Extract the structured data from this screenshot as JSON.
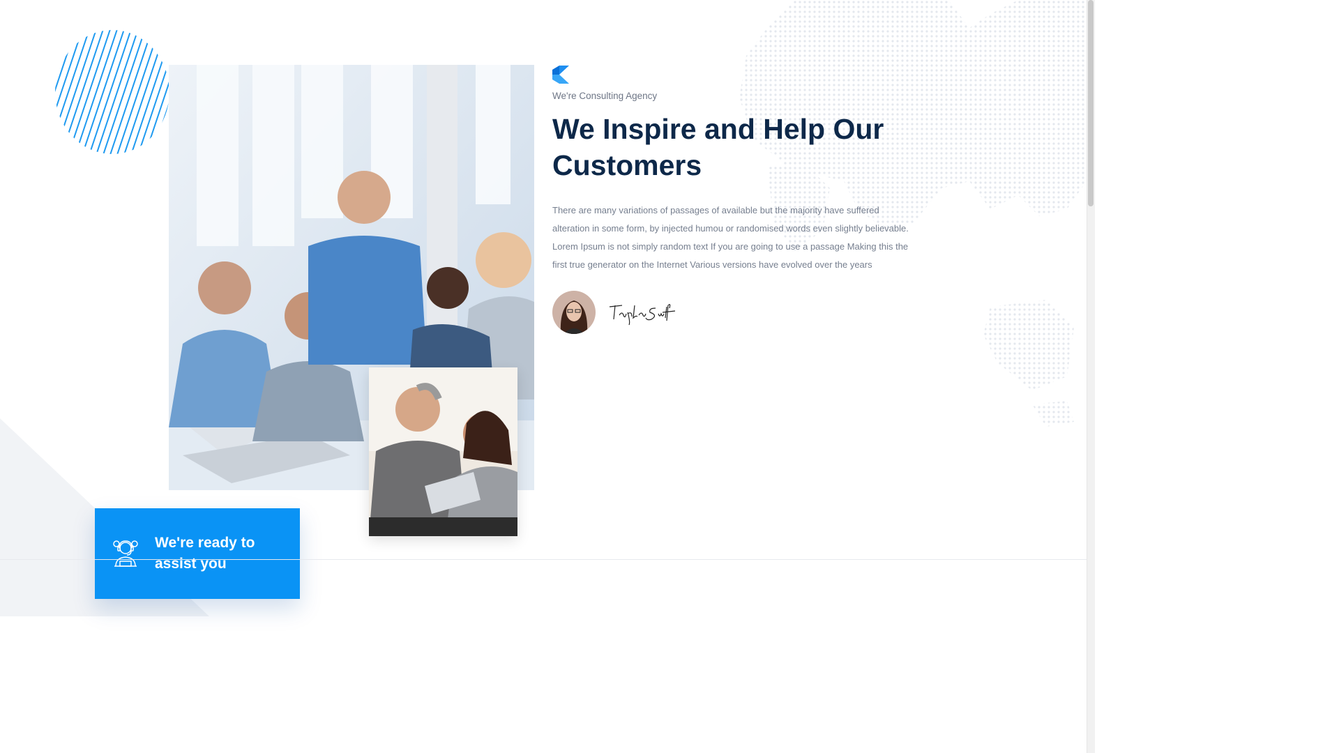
{
  "brand": {
    "icon": "brand-chevron-icon",
    "accent_color": "#0a93f5"
  },
  "about": {
    "tagline": "We're Consulting Agency",
    "headline": "We Inspire and Help Our Customers",
    "body": "There are many variations of passages of available but the majority have suffered alteration in some form, by injected humou or randomised words even slightly believable. Lorem Ipsum is not simply random text If you are going to use a passage Making this the first true generator on the Internet Various versions have evolved over the years",
    "signature_text": "Taylor Swift"
  },
  "assist_card": {
    "icon": "support-agent-icon",
    "label": "We're ready to assist you",
    "background": "#0a93f5"
  },
  "colors": {
    "heading": "#0d2849",
    "body_text": "#767f8f",
    "accent": "#0a93f5"
  }
}
